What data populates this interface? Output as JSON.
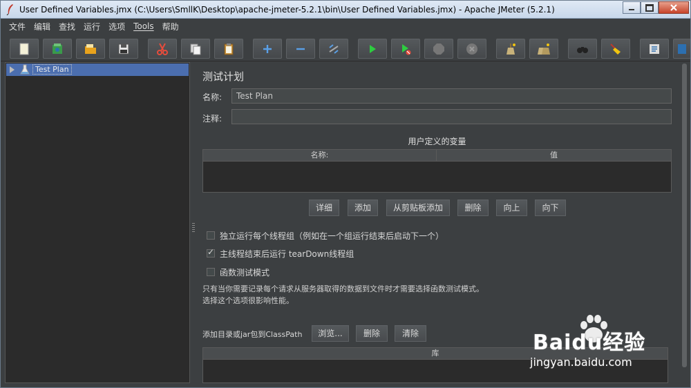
{
  "window": {
    "title": "User Defined Variables.jmx (C:\\Users\\SmllK\\Desktop\\apache-jmeter-5.2.1\\bin\\User Defined Variables.jmx) - Apache JMeter (5.2.1)"
  },
  "menu": [
    "文件",
    "编辑",
    "查找",
    "运行",
    "选项",
    "Tools",
    "帮助"
  ],
  "toolbar": {
    "icons": [
      "new-icon",
      "templates-icon",
      "open-icon",
      "save-icon",
      "cut-icon",
      "copy-icon",
      "paste-icon",
      "expand-icon",
      "collapse-icon",
      "toggle-icon",
      "start-icon",
      "start-no-pause-icon",
      "stop-icon",
      "shutdown-icon",
      "clear-icon",
      "clear-all-icon",
      "search-icon",
      "reset-search-icon",
      "function-helper-icon",
      "help-icon"
    ]
  },
  "tree": {
    "root_label": "Test Plan"
  },
  "test_plan": {
    "title": "测试计划",
    "name_label": "名称:",
    "name_value": "Test Plan",
    "comment_label": "注释:",
    "comment_value": "",
    "variables_title": "用户定义的变量",
    "columns": [
      "名称:",
      "值"
    ],
    "buttons": [
      "详细",
      "添加",
      "从剪贴板添加",
      "删除",
      "向上",
      "向下"
    ],
    "options": [
      {
        "label": "独立运行每个线程组（例如在一个组运行结束后启动下一个）",
        "checked": false
      },
      {
        "label": "主线程结束后运行 tearDown线程组",
        "checked": true
      },
      {
        "label": "函数测试模式",
        "checked": false
      }
    ],
    "note_line1": "只有当你需要记录每个请求从服务器取得的数据到文件时才需要选择函数测试模式。",
    "note_line2": "选择这个选项很影响性能。",
    "classpath_label": "添加目录或jar包到ClassPath",
    "classpath_buttons": [
      "浏览...",
      "删除",
      "清除"
    ],
    "library_column": "库"
  },
  "watermark": {
    "brand": "Baidu经验",
    "url": "jingyan.baidu.com"
  }
}
